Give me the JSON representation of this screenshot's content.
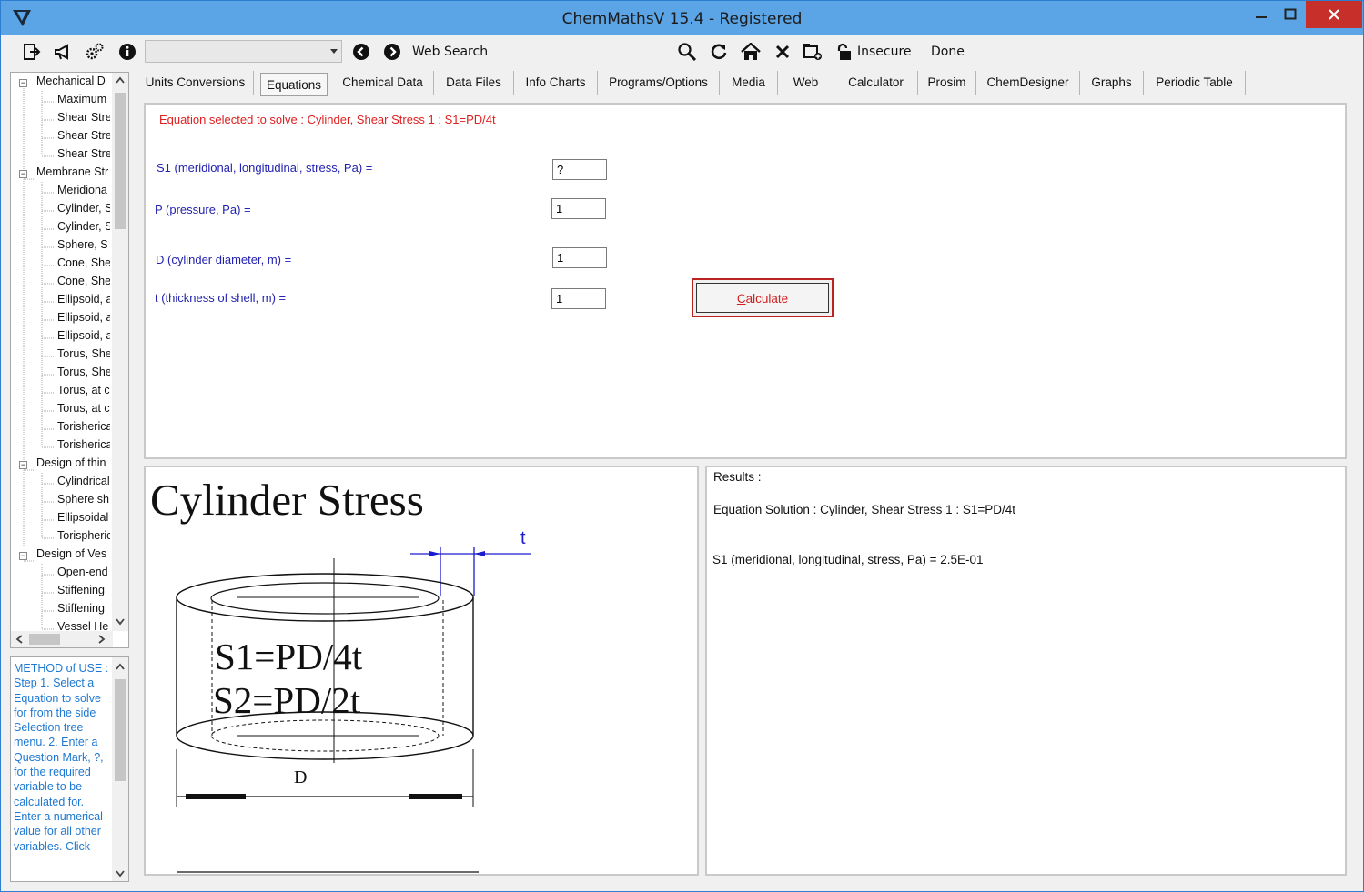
{
  "window": {
    "title": "ChemMathsV 15.4 - Registered"
  },
  "toolbar": {
    "search_label": "Web Search",
    "security_label": "Insecure",
    "status": "Done",
    "combo_value": ""
  },
  "tree": {
    "items": [
      "Mechanical D",
      "Maximum",
      "Shear Stre",
      "Shear Stre",
      "Shear Stre",
      "Membrane Str",
      "Meridiona",
      "Cylinder, S",
      "Cylinder, S",
      "Sphere, S",
      "Cone, She",
      "Cone, She",
      "Ellipsoid, a",
      "Ellipsoid, a",
      "Ellipsoid, a",
      "Torus, She",
      "Torus, She",
      "Torus, at c",
      "Torus, at c",
      "Torisherica",
      "Torisherica",
      "Design of thin",
      "Cylindrical",
      "Sphere sh",
      "Ellipsoidal",
      "Torispheric",
      "Design of Ves",
      "Open-end",
      "Stiffening",
      "Stiffening",
      "Vessel He"
    ]
  },
  "method": {
    "text": "METHOD of USE : Step 1. Select a Equation to solve for from the side Selection tree menu. 2. Enter a Question Mark, ?, for the required variable to be calculated for. Enter a numerical value for all other variables. Click"
  },
  "tabs": [
    "Units Conversions",
    "Equations",
    "Chemical Data",
    "Data Files",
    "Info Charts",
    "Programs/Options",
    "Media",
    "Web",
    "Calculator",
    "Prosim",
    "ChemDesigner",
    "Graphs",
    "Periodic Table"
  ],
  "equation": {
    "selected": "Equation selected to solve : Cylinder, Shear Stress 1 : S1=PD/4t",
    "fields": [
      {
        "label": "S1 (meridional, longitudinal, stress, Pa) =",
        "value": "?"
      },
      {
        "label": "P (pressure, Pa) =",
        "value": "1"
      },
      {
        "label": "D (cylinder diameter, m) =",
        "value": "1"
      },
      {
        "label": "t (thickness of shell, m) =",
        "value": "1"
      }
    ],
    "calculate_label": "Calculate"
  },
  "diagram": {
    "title": "Cylinder Stress",
    "formula1": "S1=PD/4t",
    "formula2": "S2=PD/2t",
    "dim_t": "t",
    "dim_d": "D"
  },
  "results": {
    "heading": "Results :",
    "solution": "Equation Solution : Cylinder, Shear Stress 1 : S1=PD/4t",
    "value_line": "S1 (meridional, longitudinal, stress, Pa) =  2.5E-01"
  },
  "colors": {
    "titlebar": "#5ba4e5",
    "close": "#c7302a",
    "label_blue": "#2222b0",
    "title_red": "#e02020",
    "method_blue": "#1e78d2"
  }
}
